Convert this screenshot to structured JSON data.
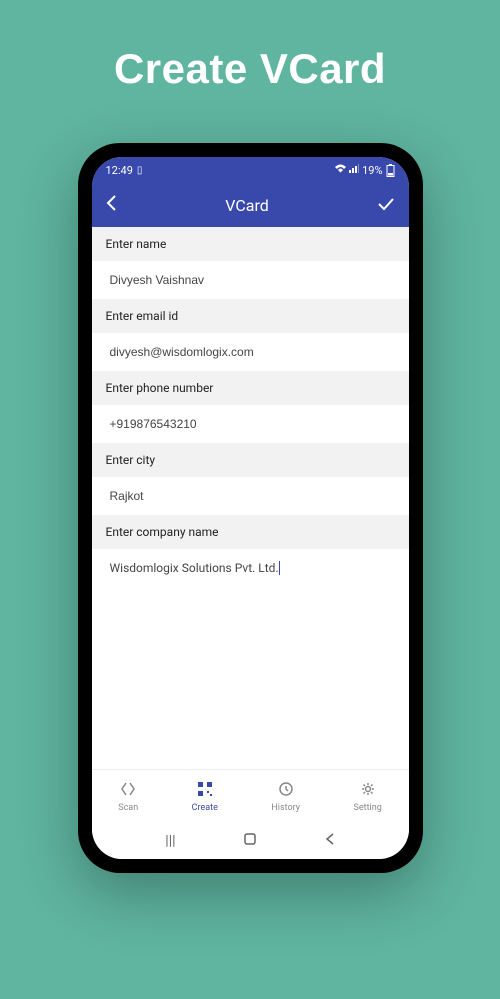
{
  "page": {
    "title": "Create VCard"
  },
  "status_bar": {
    "time": "12:49",
    "battery_percent": "19%"
  },
  "app_bar": {
    "title": "VCard"
  },
  "form": {
    "name": {
      "label": "Enter name",
      "value": "Divyesh Vaishnav"
    },
    "email": {
      "label": "Enter email id",
      "value": "divyesh@wisdomlogix.com"
    },
    "phone": {
      "label": "Enter phone number",
      "value": "+919876543210"
    },
    "city": {
      "label": "Enter city",
      "value": "Rajkot"
    },
    "company": {
      "label": "Enter company name",
      "value": "Wisdomlogix Solutions Pvt. Ltd."
    }
  },
  "bottom_nav": {
    "scan": "Scan",
    "create": "Create",
    "history": "History",
    "setting": "Setting"
  }
}
